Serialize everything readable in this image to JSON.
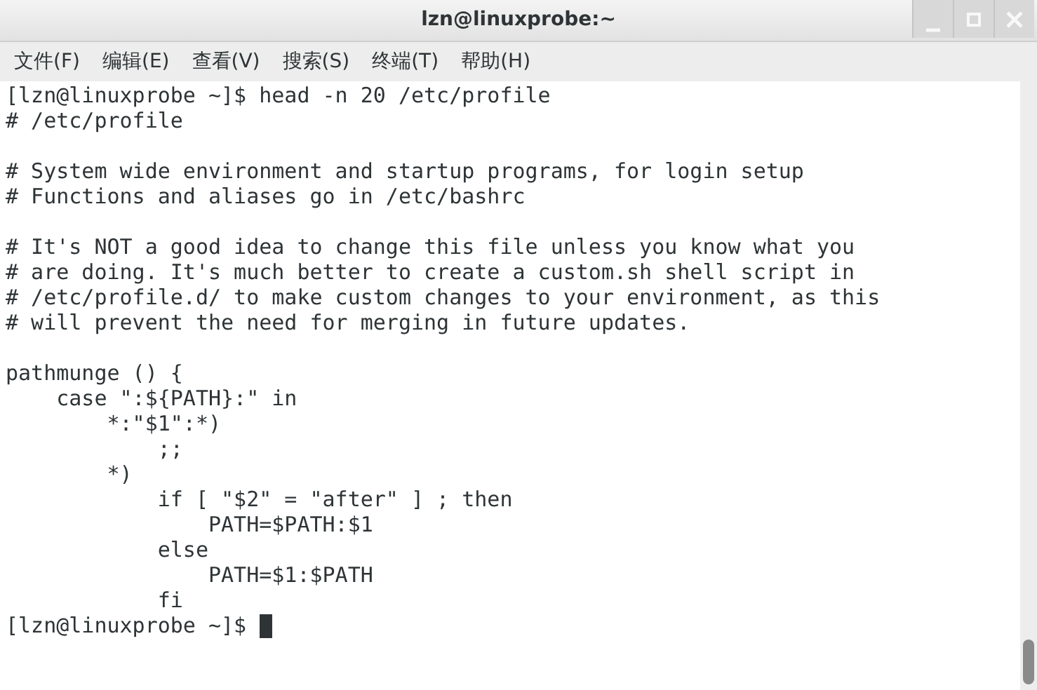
{
  "window": {
    "title": "lzn@linuxprobe:~"
  },
  "menu": [
    "文件(F)",
    "编辑(E)",
    "查看(V)",
    "搜索(S)",
    "终端(T)",
    "帮助(H)"
  ],
  "terminal": {
    "paragraphs": [
      [
        "[lzn@linuxprobe ~]$ head -n 20 /etc/profile",
        "# /etc/profile"
      ],
      [
        "# System wide environment and startup programs, for login setup",
        "# Functions and aliases go in /etc/bashrc"
      ],
      [
        "# It's NOT a good idea to change this file unless you know what you",
        "# are doing. It's much better to create a custom.sh shell script in",
        "# /etc/profile.d/ to make custom changes to your environment, as this",
        "# will prevent the need for merging in future updates."
      ],
      [
        "pathmunge () {",
        "    case \":${PATH}:\" in",
        "        *:\"$1\":*)",
        "            ;;",
        "        *)",
        "            if [ \"$2\" = \"after\" ] ; then",
        "                PATH=$PATH:$1",
        "            else",
        "                PATH=$1:$PATH",
        "            fi",
        "[lzn@linuxprobe ~]$"
      ]
    ],
    "cursor": true
  }
}
